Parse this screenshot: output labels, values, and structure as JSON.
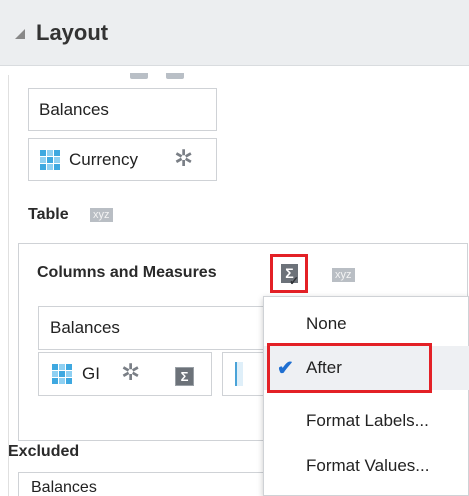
{
  "panel": {
    "title": "Layout"
  },
  "top_section": {
    "row_value": "Balances",
    "column_value": "Currency"
  },
  "table_section": {
    "label": "Table",
    "badge": "xyz",
    "columns_label": "Columns and Measures",
    "columns_badge": "xyz",
    "row_value": "Balances",
    "column_value": "GI",
    "sigma_symbol": "Σ"
  },
  "totals_menu": {
    "items": [
      "None",
      "After",
      "Format Labels...",
      "Format Values..."
    ],
    "selected": "After"
  },
  "excluded_section": {
    "label": "Excluded",
    "value": "Balances"
  }
}
